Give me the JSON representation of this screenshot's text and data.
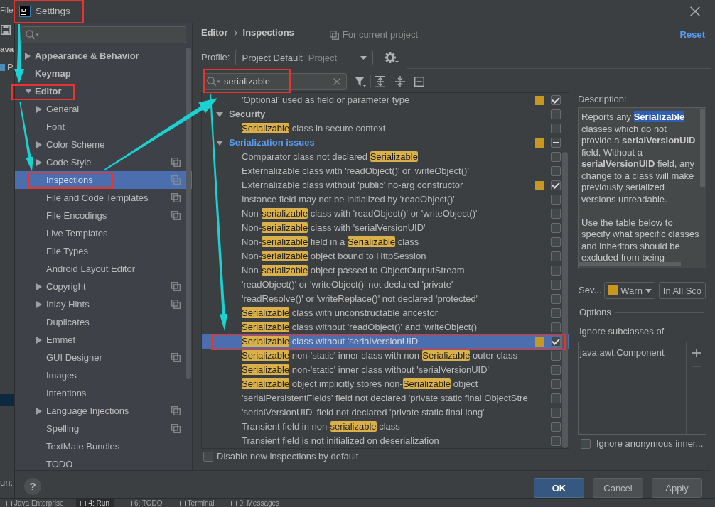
{
  "ide": {
    "menu": "File",
    "panel_title": "ava",
    "tree_item": "P",
    "run_label": "un:",
    "tool_tabs": [
      {
        "label": "Java Enterprise",
        "selected": false
      },
      {
        "label": "4: Run",
        "selected": true
      },
      {
        "label": "6: TODO",
        "selected": false
      },
      {
        "label": "Terminal",
        "selected": false
      },
      {
        "label": "0: Messages",
        "selected": false
      }
    ]
  },
  "window": {
    "logo": "IJ",
    "title": "Settings"
  },
  "sidebar": {
    "items": [
      {
        "label": "Appearance & Behavior",
        "expanded": false,
        "selected": false,
        "project_scope": false
      },
      {
        "label": "Keymap",
        "selected": false,
        "project_scope": false
      },
      {
        "label": "Editor",
        "expanded": true,
        "selected": false,
        "project_scope": false,
        "children": [
          {
            "label": "General",
            "expanded": false,
            "selected": false,
            "project_scope": false
          },
          {
            "label": "Font",
            "selected": false,
            "project_scope": false
          },
          {
            "label": "Color Scheme",
            "expanded": false,
            "selected": false,
            "project_scope": false
          },
          {
            "label": "Code Style",
            "expanded": false,
            "selected": false,
            "project_scope": true
          },
          {
            "label": "Inspections",
            "selected": true,
            "project_scope": true
          },
          {
            "label": "File and Code Templates",
            "selected": false,
            "project_scope": true
          },
          {
            "label": "File Encodings",
            "selected": false,
            "project_scope": true
          },
          {
            "label": "Live Templates",
            "selected": false,
            "project_scope": false
          },
          {
            "label": "File Types",
            "selected": false,
            "project_scope": false
          },
          {
            "label": "Android Layout Editor",
            "selected": false,
            "project_scope": false
          },
          {
            "label": "Copyright",
            "expanded": false,
            "selected": false,
            "project_scope": true
          },
          {
            "label": "Inlay Hints",
            "expanded": false,
            "selected": false,
            "project_scope": true
          },
          {
            "label": "Duplicates",
            "selected": false,
            "project_scope": false
          },
          {
            "label": "Emmet",
            "expanded": false,
            "selected": false,
            "project_scope": false
          },
          {
            "label": "GUI Designer",
            "selected": false,
            "project_scope": true
          },
          {
            "label": "Images",
            "selected": false,
            "project_scope": false
          },
          {
            "label": "Intentions",
            "selected": false,
            "project_scope": false
          },
          {
            "label": "Language Injections",
            "expanded": false,
            "selected": false,
            "project_scope": true
          },
          {
            "label": "Spelling",
            "selected": false,
            "project_scope": true
          },
          {
            "label": "TextMate Bundles",
            "selected": false,
            "project_scope": false
          },
          {
            "label": "TODO",
            "selected": false,
            "project_scope": false
          }
        ]
      }
    ]
  },
  "header": {
    "breadcrumb": [
      "Editor",
      "Inspections"
    ],
    "scope_note": "For current project",
    "reset": "Reset"
  },
  "profile": {
    "label": "Profile:",
    "value": "Project Default",
    "scope": "Project"
  },
  "inspection_search": {
    "value": "serializable"
  },
  "inspection_tree": [
    {
      "kind": "continued_group",
      "children": [
        {
          "kind": "inspection",
          "segments": [
            {
              "text": "'Optional' used as field or parameter type",
              "match": false
            }
          ],
          "severity_marker": true,
          "checked": true,
          "selected": false
        }
      ]
    },
    {
      "kind": "group",
      "label": "Security",
      "expanded": true,
      "modified": false,
      "severity_marker": false,
      "mixed": false,
      "selected": false,
      "children": [
        {
          "kind": "inspection",
          "segments": [
            {
              "text": "Serializable",
              "match": true
            },
            {
              "text": " class in secure context",
              "match": false
            }
          ],
          "severity_marker": false,
          "checked": false,
          "selected": false
        }
      ]
    },
    {
      "kind": "group",
      "label": "Serialization issues",
      "expanded": true,
      "modified": true,
      "severity_marker": true,
      "mixed": true,
      "selected": false,
      "children": [
        {
          "kind": "inspection",
          "segments": [
            {
              "text": "Comparator class not declared ",
              "match": false
            },
            {
              "text": "Serializable",
              "match": true
            }
          ],
          "severity_marker": false,
          "checked": false,
          "selected": false
        },
        {
          "kind": "inspection",
          "segments": [
            {
              "text": "Externalizable class with 'readObject()' or 'writeObject()'",
              "match": false
            }
          ],
          "severity_marker": false,
          "checked": false,
          "selected": false
        },
        {
          "kind": "inspection",
          "segments": [
            {
              "text": "Externalizable class without 'public' no-arg constructor",
              "match": false
            }
          ],
          "severity_marker": true,
          "checked": true,
          "selected": false
        },
        {
          "kind": "inspection",
          "segments": [
            {
              "text": "Instance field may not be initialized by 'readObject()'",
              "match": false
            }
          ],
          "severity_marker": false,
          "checked": false,
          "selected": false
        },
        {
          "kind": "inspection",
          "segments": [
            {
              "text": "Non-",
              "match": false
            },
            {
              "text": "serializable",
              "match": true
            },
            {
              "text": " class with 'readObject()' or 'writeObject()'",
              "match": false
            }
          ],
          "severity_marker": false,
          "checked": false,
          "selected": false
        },
        {
          "kind": "inspection",
          "segments": [
            {
              "text": "Non-",
              "match": false
            },
            {
              "text": "serializable",
              "match": true
            },
            {
              "text": " class with 'serialVersionUID'",
              "match": false
            }
          ],
          "severity_marker": false,
          "checked": false,
          "selected": false
        },
        {
          "kind": "inspection",
          "segments": [
            {
              "text": "Non-",
              "match": false
            },
            {
              "text": "serializable",
              "match": true
            },
            {
              "text": " field in a ",
              "match": false
            },
            {
              "text": "Serializable",
              "match": true
            },
            {
              "text": " class",
              "match": false
            }
          ],
          "severity_marker": false,
          "checked": false,
          "selected": false
        },
        {
          "kind": "inspection",
          "segments": [
            {
              "text": "Non-",
              "match": false
            },
            {
              "text": "serializable",
              "match": true
            },
            {
              "text": " object bound to HttpSession",
              "match": false
            }
          ],
          "severity_marker": false,
          "checked": false,
          "selected": false
        },
        {
          "kind": "inspection",
          "segments": [
            {
              "text": "Non-",
              "match": false
            },
            {
              "text": "serializable",
              "match": true
            },
            {
              "text": " object passed to ObjectOutputStream",
              "match": false
            }
          ],
          "severity_marker": false,
          "checked": false,
          "selected": false
        },
        {
          "kind": "inspection",
          "segments": [
            {
              "text": "'readObject()' or 'writeObject()' not declared 'private'",
              "match": false
            }
          ],
          "severity_marker": false,
          "checked": false,
          "selected": false
        },
        {
          "kind": "inspection",
          "segments": [
            {
              "text": "'readResolve()' or 'writeReplace()' not declared 'protected'",
              "match": false
            }
          ],
          "severity_marker": false,
          "checked": false,
          "selected": false
        },
        {
          "kind": "inspection",
          "segments": [
            {
              "text": "Serializable",
              "match": true
            },
            {
              "text": " class with unconstructable ancestor",
              "match": false
            }
          ],
          "severity_marker": false,
          "checked": false,
          "selected": false
        },
        {
          "kind": "inspection",
          "segments": [
            {
              "text": "Serializable",
              "match": true
            },
            {
              "text": " class without 'readObject()' and 'writeObject()'",
              "match": false
            }
          ],
          "severity_marker": false,
          "checked": false,
          "selected": false
        },
        {
          "kind": "inspection",
          "segments": [
            {
              "text": "Serializable",
              "match": true
            },
            {
              "text": " class without 'serialVersionUID'",
              "match": false
            }
          ],
          "severity_marker": true,
          "checked": true,
          "selected": true
        },
        {
          "kind": "inspection",
          "segments": [
            {
              "text": "Serializable",
              "match": true
            },
            {
              "text": " non-'static' inner class with non-",
              "match": false
            },
            {
              "text": "Serializable",
              "match": true
            },
            {
              "text": " outer class",
              "match": false
            }
          ],
          "severity_marker": false,
          "checked": false,
          "selected": false
        },
        {
          "kind": "inspection",
          "segments": [
            {
              "text": "Serializable",
              "match": true
            },
            {
              "text": " non-'static' inner class without 'serialVersionUID'",
              "match": false
            }
          ],
          "severity_marker": false,
          "checked": false,
          "selected": false
        },
        {
          "kind": "inspection",
          "segments": [
            {
              "text": "Serializable",
              "match": true
            },
            {
              "text": " object implicitly stores non-",
              "match": false
            },
            {
              "text": "Serializable",
              "match": true
            },
            {
              "text": " object",
              "match": false
            }
          ],
          "severity_marker": false,
          "checked": false,
          "selected": false
        },
        {
          "kind": "inspection",
          "segments": [
            {
              "text": "'serialPersistentFields' field not declared 'private static final ObjectStre",
              "match": false
            }
          ],
          "severity_marker": false,
          "checked": false,
          "selected": false
        },
        {
          "kind": "inspection",
          "segments": [
            {
              "text": "'serialVersionUID' field not declared 'private static final long'",
              "match": false
            }
          ],
          "severity_marker": false,
          "checked": false,
          "selected": false
        },
        {
          "kind": "inspection",
          "segments": [
            {
              "text": "Transient field in non-",
              "match": false
            },
            {
              "text": "serializable",
              "match": true
            },
            {
              "text": " class",
              "match": false
            }
          ],
          "severity_marker": false,
          "checked": false,
          "selected": false
        },
        {
          "kind": "inspection",
          "segments": [
            {
              "text": "Transient field is not initialized on deserialization",
              "match": false
            }
          ],
          "severity_marker": false,
          "checked": false,
          "selected": false
        }
      ]
    }
  ],
  "disable_new": {
    "label": "Disable new inspections by default",
    "checked": false
  },
  "description": {
    "heading": "Description:",
    "paragraphs": [
      [
        {
          "text": "Reports any ",
          "match": false
        },
        {
          "text": "**Serializable**",
          "match": true
        },
        {
          "text": " classes which do not provide a **serialVersionUID** field. Without a **serialVersionUID** field, any change to a class will make previously serialized versions unreadable.",
          "match": false
        }
      ],
      [
        {
          "text": "Use the table below to specify what specific classes and inheritors should be excluded from being",
          "match": false
        }
      ]
    ]
  },
  "severity": {
    "label": "Sev...",
    "value": "Warn",
    "scope": "In All Sco"
  },
  "options": {
    "heading": "Options",
    "subclasses_heading": "Ignore subclasses of",
    "subclasses": [
      "java.awt.Component"
    ],
    "list_buttons": [
      {
        "kind": "add",
        "disabled": false
      },
      {
        "kind": "remove",
        "disabled": true
      }
    ],
    "ignore_anonymous": {
      "label": "Ignore anonymous inner...",
      "checked": false
    }
  },
  "footer": {
    "help": "?",
    "buttons": [
      {
        "label": "OK",
        "default": true
      },
      {
        "label": "Cancel",
        "default": false
      },
      {
        "label": "Apply",
        "default": false
      }
    ]
  }
}
